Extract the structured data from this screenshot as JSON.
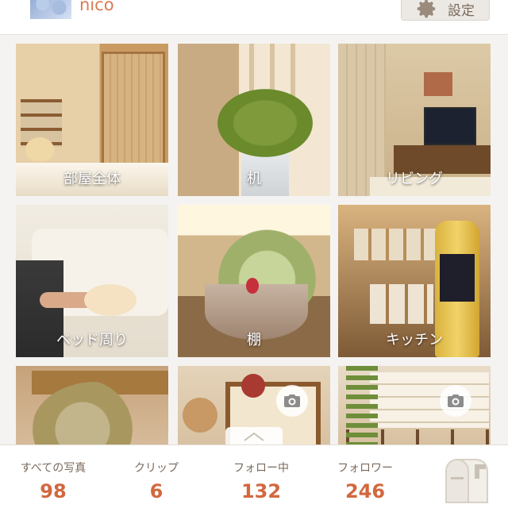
{
  "header": {
    "username": "nico",
    "settings_label": "設定",
    "settings_icon": "gear-icon"
  },
  "tiles": [
    {
      "label": "部屋全体",
      "art": "room"
    },
    {
      "label": "机",
      "art": "desk"
    },
    {
      "label": "リビング",
      "art": "living"
    },
    {
      "label": "ベッド周り",
      "art": "bed"
    },
    {
      "label": "棚",
      "art": "shelf"
    },
    {
      "label": "キッチン",
      "art": "kitchen"
    },
    {
      "label": "",
      "art": "wreath"
    },
    {
      "label": "",
      "art": "hooks",
      "camera": true
    },
    {
      "label": "",
      "art": "bath",
      "camera": true
    }
  ],
  "stats": [
    {
      "label": "すべての写真",
      "value": "98"
    },
    {
      "label": "クリップ",
      "value": "6"
    },
    {
      "label": "フォロー中",
      "value": "132"
    },
    {
      "label": "フォロワー",
      "value": "246"
    }
  ],
  "icons": {
    "camera": "camera-icon",
    "mailbox": "mailbox-icon",
    "scroll_top": "chevron-up-icon"
  },
  "colors": {
    "accent": "#dc7a52",
    "stat_value": "#d2683e",
    "muted_text": "#7a6a5c"
  }
}
